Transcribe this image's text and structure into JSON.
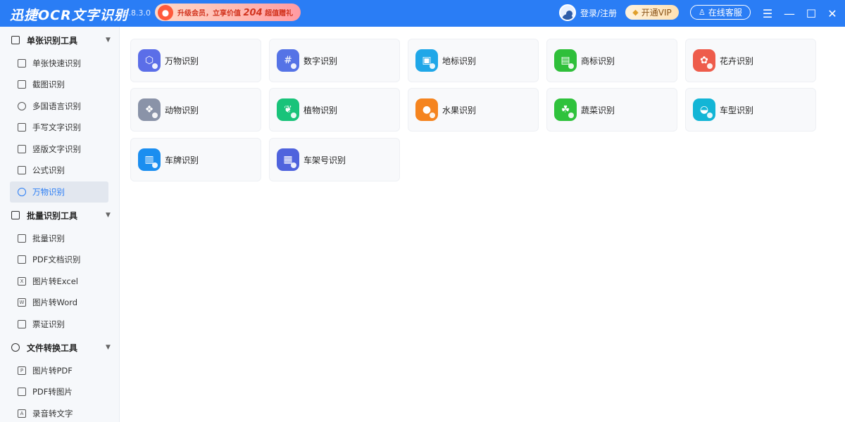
{
  "titlebar": {
    "app_name": "迅捷OCR文字识别",
    "version": "v8.8.3.0",
    "promo": {
      "prefix": "升级会员，立享价值",
      "number": "204",
      "suffix": "超值赠礼"
    },
    "login_label": "登录/注册",
    "vip_label": "开通VIP",
    "service_label": "在线客服",
    "window_controls": [
      "menu-icon",
      "minimize-icon",
      "maximize-icon",
      "close-icon"
    ]
  },
  "sidebar": {
    "groups": [
      {
        "label": "单张识别工具",
        "items": [
          {
            "label": "单张快速识别",
            "icon": "single-icon"
          },
          {
            "label": "截图识别",
            "icon": "crop-icon"
          },
          {
            "label": "多国语言识别",
            "icon": "globe-icon"
          },
          {
            "label": "手写文字识别",
            "icon": "pen-icon"
          },
          {
            "label": "竖版文字识别",
            "icon": "vertical-text-icon"
          },
          {
            "label": "公式识别",
            "icon": "formula-icon"
          },
          {
            "label": "万物识别",
            "icon": "objects-icon",
            "active": true
          }
        ]
      },
      {
        "label": "批量识别工具",
        "items": [
          {
            "label": "批量识别",
            "icon": "batch-icon"
          },
          {
            "label": "PDF文档识别",
            "icon": "pdf-icon"
          },
          {
            "label": "图片转Excel",
            "icon": "excel-icon"
          },
          {
            "label": "图片转Word",
            "icon": "word-icon"
          },
          {
            "label": "票证识别",
            "icon": "ticket-icon"
          }
        ]
      },
      {
        "label": "文件转换工具",
        "items": [
          {
            "label": "图片转PDF",
            "icon": "image-pdf-icon"
          },
          {
            "label": "PDF转图片",
            "icon": "pdf-image-icon"
          },
          {
            "label": "录音转文字",
            "icon": "audio-icon"
          }
        ]
      }
    ]
  },
  "cards": [
    {
      "label": "万物识别",
      "icon": "objects-icon",
      "color": "#5b6ee8"
    },
    {
      "label": "数字识别",
      "icon": "number-icon",
      "color": "#5573e6"
    },
    {
      "label": "地标识别",
      "icon": "landmark-icon",
      "color": "#1fa7e8"
    },
    {
      "label": "商标识别",
      "icon": "trademark-icon",
      "color": "#2fbf3a"
    },
    {
      "label": "花卉识别",
      "icon": "flower-icon",
      "color": "#ee5c4b"
    },
    {
      "label": "动物识别",
      "icon": "animal-icon",
      "color": "#8a93a8"
    },
    {
      "label": "植物识别",
      "icon": "plant-icon",
      "color": "#19c37a"
    },
    {
      "label": "水果识别",
      "icon": "fruit-icon",
      "color": "#f5841f"
    },
    {
      "label": "蔬菜识别",
      "icon": "vegetable-icon",
      "color": "#2fc23c"
    },
    {
      "label": "车型识别",
      "icon": "car-icon",
      "color": "#13b5d6"
    },
    {
      "label": "车牌识别",
      "icon": "license-plate-icon",
      "color": "#1b8ef0"
    },
    {
      "label": "车架号识别",
      "icon": "vin-icon",
      "color": "#4f63dd"
    }
  ]
}
